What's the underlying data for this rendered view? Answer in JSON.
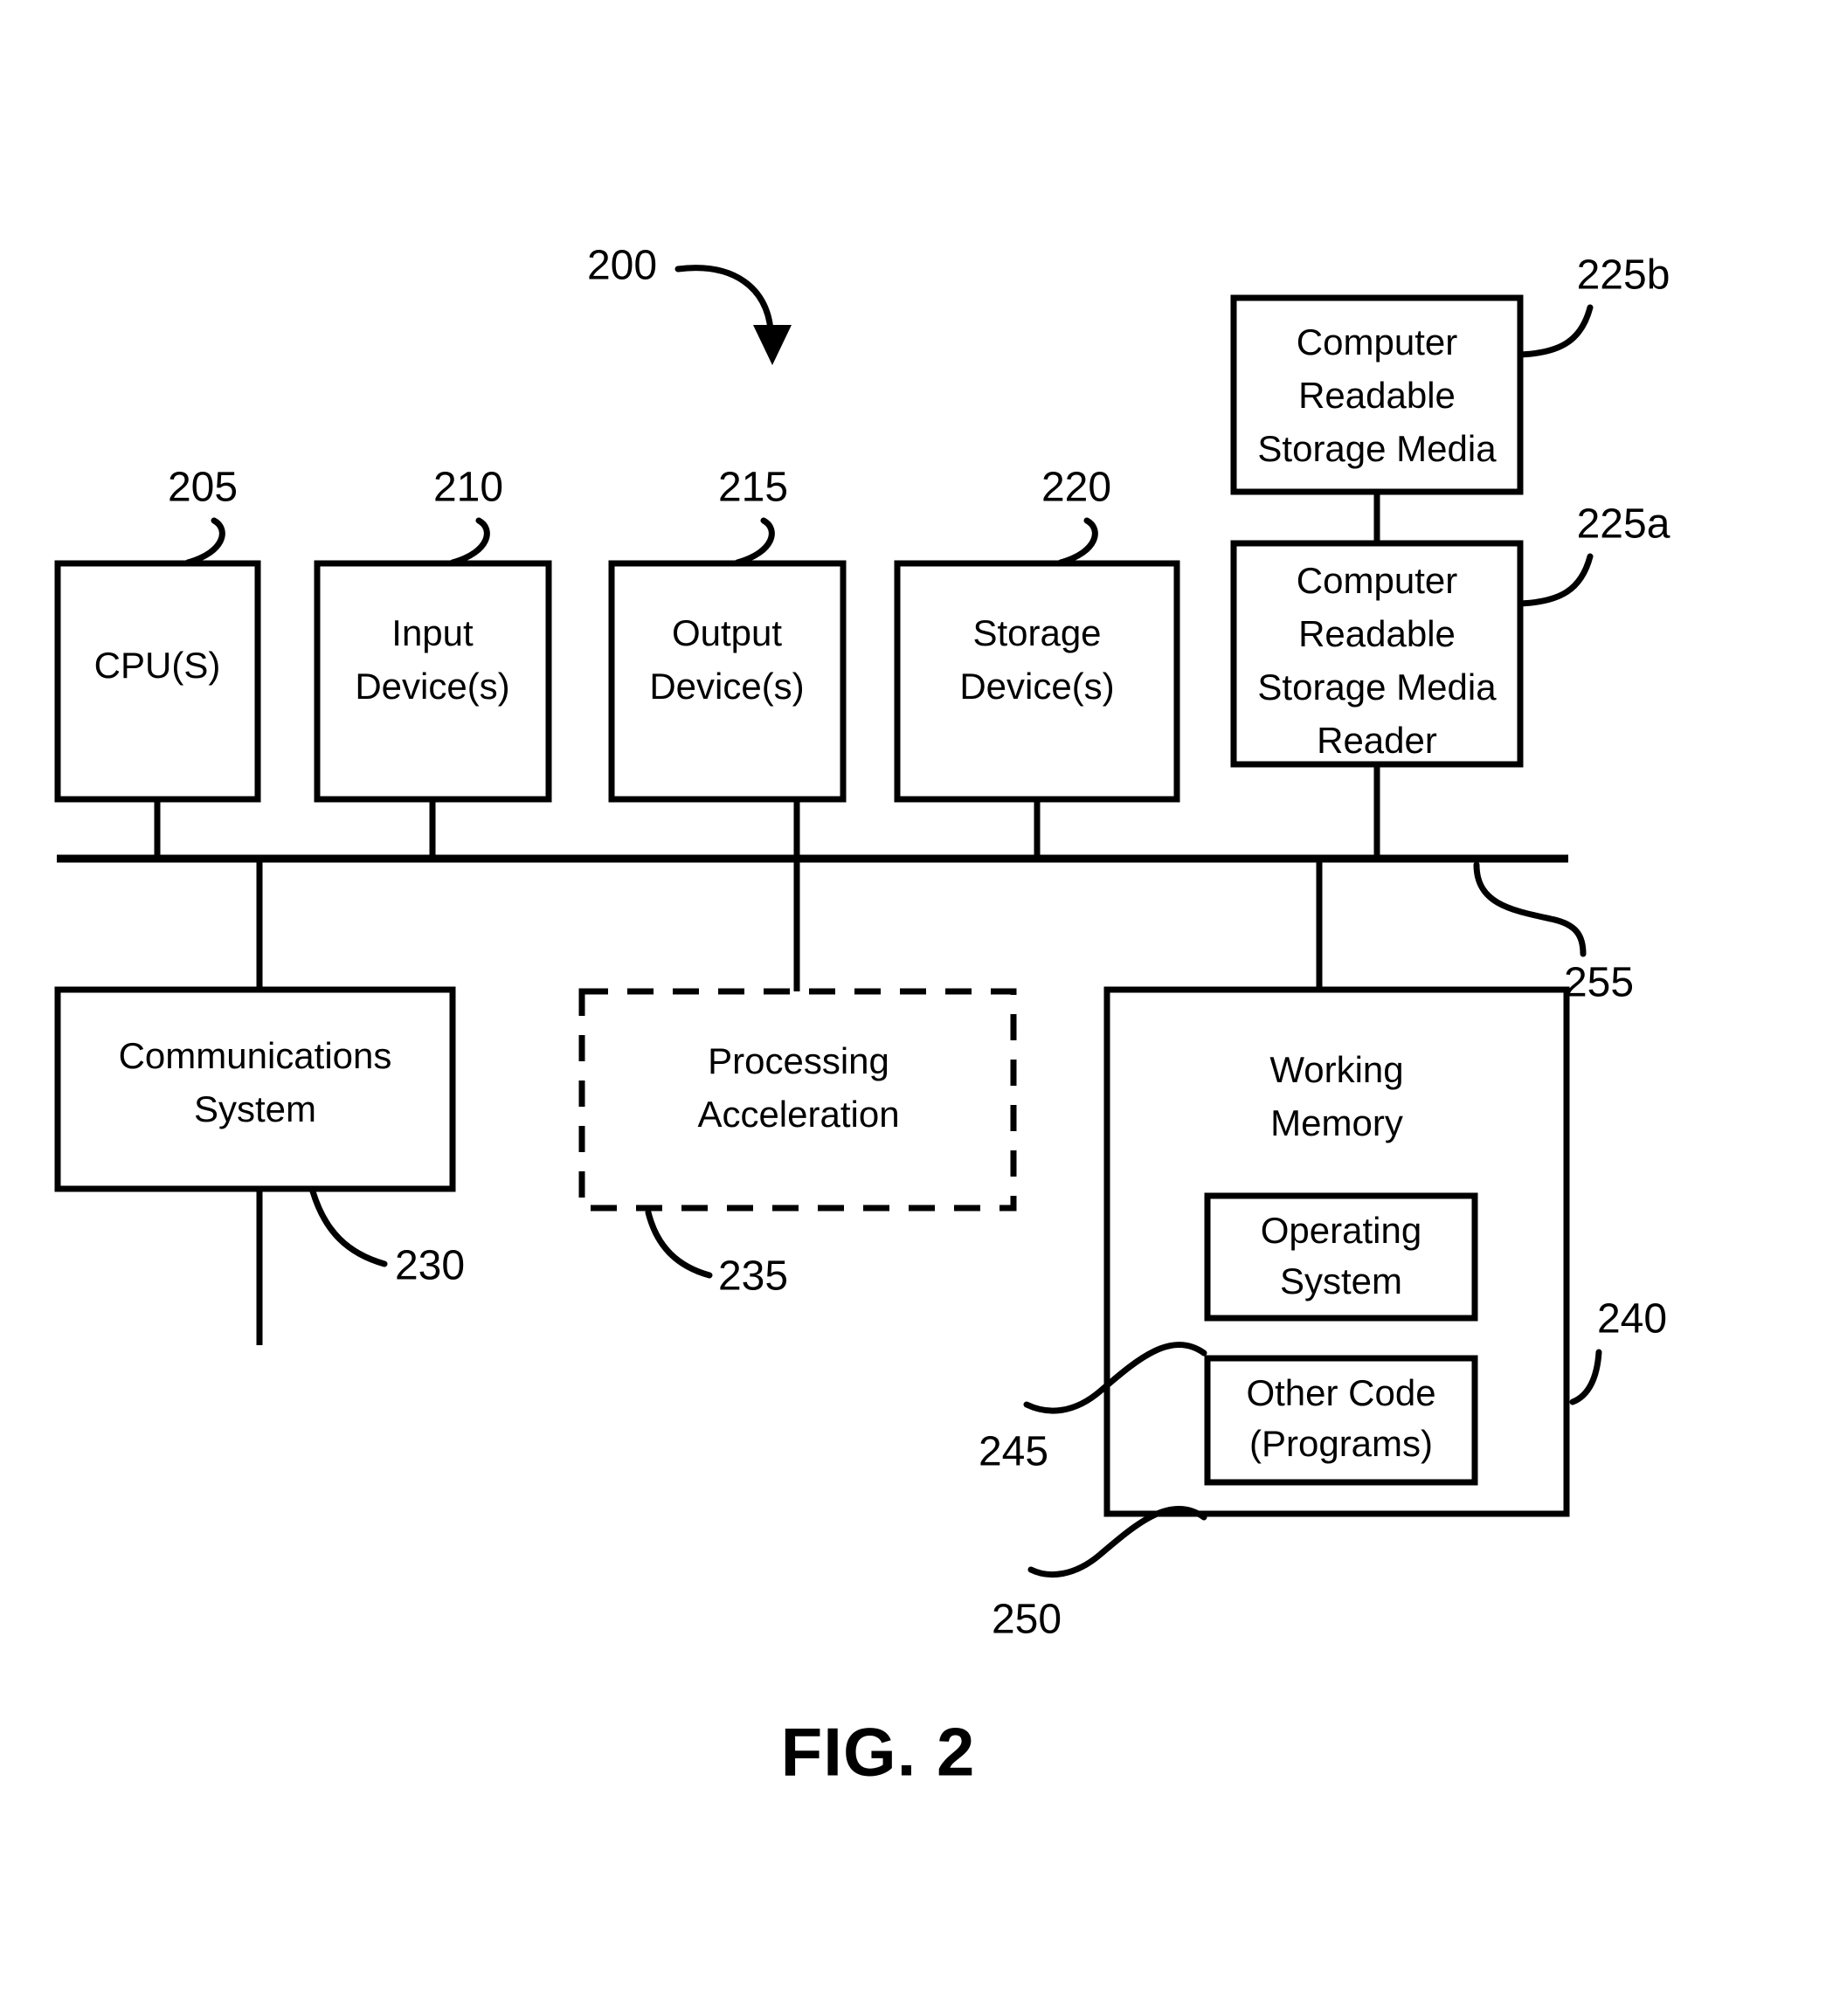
{
  "figure": {
    "caption": "FIG. 2",
    "system_ref": "200"
  },
  "blocks": [
    {
      "id": "cpu",
      "lines": [
        "CPU(S)"
      ],
      "ref": "205"
    },
    {
      "id": "input",
      "lines": [
        "Input",
        "Device(s)"
      ],
      "ref": "210"
    },
    {
      "id": "output",
      "lines": [
        "Output",
        "Device(s)"
      ],
      "ref": "215"
    },
    {
      "id": "storage",
      "lines": [
        "Storage",
        "Device(s)"
      ],
      "ref": "220"
    },
    {
      "id": "crsm",
      "lines": [
        "Computer",
        "Readable",
        "Storage Media"
      ],
      "ref": "225b"
    },
    {
      "id": "crsm-reader",
      "lines": [
        "Computer",
        "Readable",
        "Storage Media",
        "Reader"
      ],
      "ref": "225a"
    },
    {
      "id": "comms",
      "lines": [
        "Communications",
        "System"
      ],
      "ref": "230"
    },
    {
      "id": "accel",
      "lines": [
        "Processing",
        "Acceleration"
      ],
      "ref": "235"
    },
    {
      "id": "working-mem",
      "lines": [
        "Working",
        "Memory"
      ],
      "ref": "240"
    },
    {
      "id": "os",
      "lines": [
        "Operating",
        "System"
      ],
      "ref": "245"
    },
    {
      "id": "other-code",
      "lines": [
        "Other Code",
        "(Programs)"
      ],
      "ref": "250"
    },
    {
      "id": "bus",
      "lines": [],
      "ref": "255"
    }
  ],
  "text": {
    "cpu_l0": "CPU(S)",
    "input_l0": "Input",
    "input_l1": "Device(s)",
    "output_l0": "Output",
    "output_l1": "Device(s)",
    "storage_l0": "Storage",
    "storage_l1": "Device(s)",
    "crsm_l0": "Computer",
    "crsm_l1": "Readable",
    "crsm_l2": "Storage Media",
    "reader_l0": "Computer",
    "reader_l1": "Readable",
    "reader_l2": "Storage Media",
    "reader_l3": "Reader",
    "comms_l0": "Communications",
    "comms_l1": "System",
    "accel_l0": "Processing",
    "accel_l1": "Acceleration",
    "wmem_l0": "Working",
    "wmem_l1": "Memory",
    "os_l0": "Operating",
    "os_l1": "System",
    "code_l0": "Other Code",
    "code_l1": "(Programs)"
  },
  "refs": {
    "r200": "200",
    "r205": "205",
    "r210": "210",
    "r215": "215",
    "r220": "220",
    "r225a": "225a",
    "r225b": "225b",
    "r230": "230",
    "r235": "235",
    "r240": "240",
    "r245": "245",
    "r250": "250",
    "r255": "255"
  },
  "colors": {
    "ink": "#000000",
    "paper": "#ffffff"
  }
}
